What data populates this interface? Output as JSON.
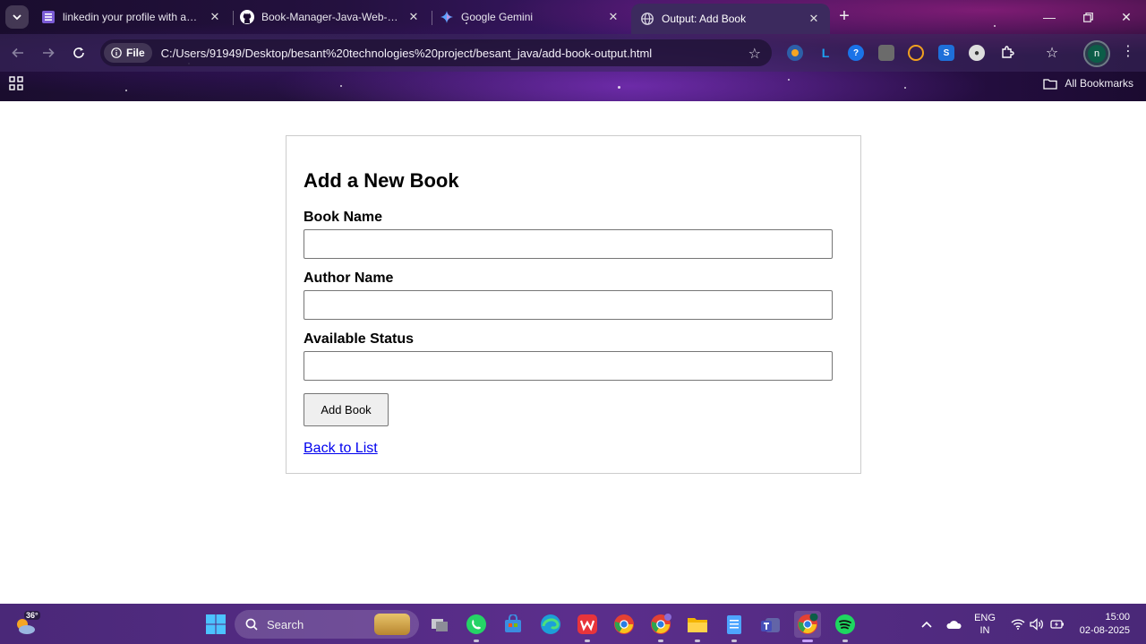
{
  "browser": {
    "tabs": [
      {
        "title": "linkedin your profile with access",
        "icon": "list-icon",
        "active": false
      },
      {
        "title": "Book-Manager-Java-Web-Application",
        "icon": "github-icon",
        "active": false
      },
      {
        "title": "Google Gemini",
        "icon": "gemini-icon",
        "active": false
      },
      {
        "title": "Output: Add Book",
        "icon": "globe-icon",
        "active": true
      }
    ],
    "address": {
      "chip_label": "File",
      "url": "C:/Users/91949/Desktop/besant%20technologies%20project/besant_java/add-book-output.html"
    },
    "profile_initial": "n",
    "bookmarks_label": "All Bookmarks"
  },
  "form": {
    "heading": "Add a New Book",
    "fields": [
      {
        "label": "Book Name",
        "value": ""
      },
      {
        "label": "Author Name",
        "value": ""
      },
      {
        "label": "Available Status",
        "value": ""
      }
    ],
    "submit_label": "Add Book",
    "back_link": "Back to List"
  },
  "taskbar": {
    "weather_temp": "36°",
    "search_placeholder": "Search",
    "language_line1": "ENG",
    "language_line2": "IN",
    "time": "15:00",
    "date": "02-08-2025"
  },
  "colors": {
    "link": "#0000ee",
    "taskbar": "#5b2e8c",
    "chrome_active_tab": "#3c2a5e"
  }
}
